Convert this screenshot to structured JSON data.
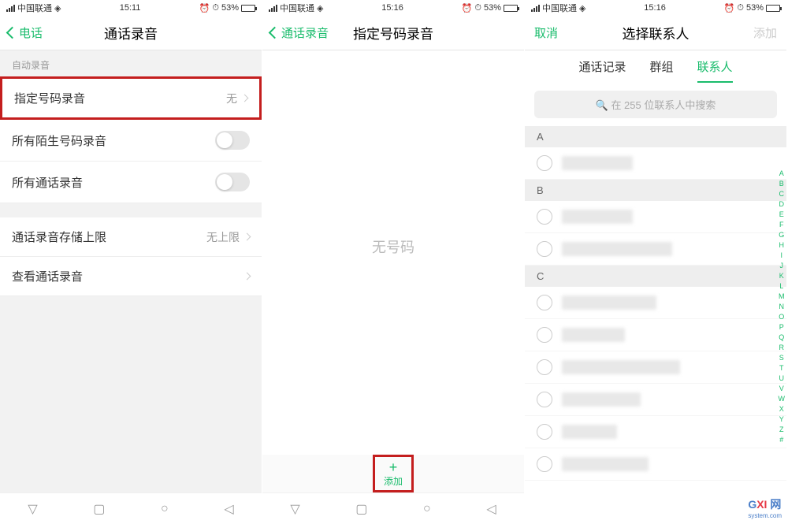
{
  "status": {
    "carrier": "中国联通",
    "time1": "15:11",
    "time2": "15:16",
    "time3": "15:16",
    "battery": "53%",
    "alarm_icon": "⏰",
    "clock_icon": "⏱"
  },
  "screen1": {
    "back_label": "电话",
    "title": "通话录音",
    "section_auto": "自动录音",
    "item_specific": "指定号码录音",
    "item_specific_value": "无",
    "item_unknown": "所有陌生号码录音",
    "item_all": "所有通话录音",
    "item_limit": "通话录音存储上限",
    "item_limit_value": "无上限",
    "item_view": "查看通话录音"
  },
  "screen2": {
    "back_label": "通话录音",
    "title": "指定号码录音",
    "empty": "无号码",
    "add": "添加"
  },
  "screen3": {
    "cancel": "取消",
    "title": "选择联系人",
    "add": "添加",
    "tab1": "通话记录",
    "tab2": "群组",
    "tab3": "联系人",
    "search_placeholder": "在 255 位联系人中搜索",
    "sections": [
      "A",
      "B",
      "C"
    ],
    "alpha": [
      "A",
      "B",
      "C",
      "D",
      "E",
      "F",
      "G",
      "H",
      "I",
      "J",
      "K",
      "L",
      "M",
      "N",
      "O",
      "P",
      "Q",
      "R",
      "S",
      "T",
      "U",
      "V",
      "W",
      "X",
      "Y",
      "Z",
      "#"
    ]
  },
  "watermark": {
    "main_g": "G",
    "main_xi": "XI",
    "main_net": "网",
    "sub": "system.com"
  }
}
